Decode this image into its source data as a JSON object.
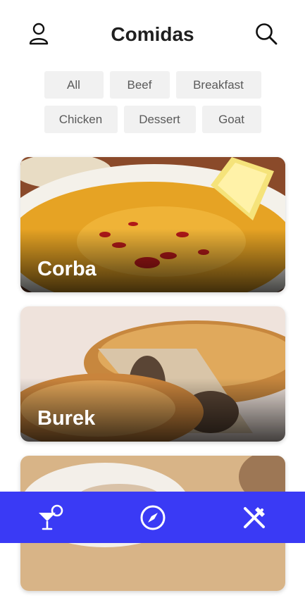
{
  "header": {
    "title": "Comidas",
    "profile_icon": "person-icon",
    "search_icon": "search-icon"
  },
  "categories": [
    "All",
    "Beef",
    "Breakfast",
    "Chicken",
    "Dessert",
    "Goat"
  ],
  "meals": [
    {
      "name": "Corba"
    },
    {
      "name": "Burek"
    },
    {
      "name": ""
    }
  ],
  "bottom_nav": {
    "items": [
      "cocktail-icon",
      "compass-icon",
      "fork-knife-icon"
    ],
    "color": "#3a3af5"
  }
}
